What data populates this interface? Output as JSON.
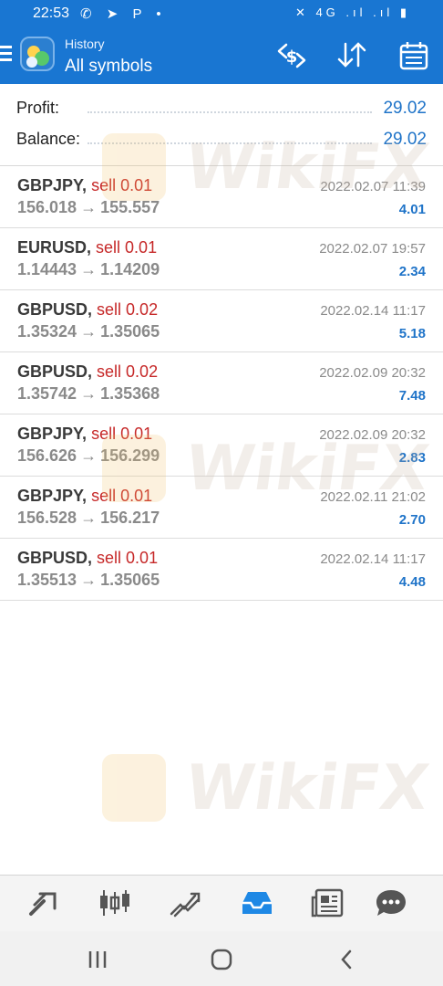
{
  "status_bar": {
    "time": "22:53",
    "left_icons": "✆ ➤ P •",
    "right_icons": "✕ 4G .ıl .ıl ▮"
  },
  "header": {
    "subtitle": "History",
    "title": "All symbols",
    "icons": [
      "menu-icon",
      "exchange-icon",
      "sort-icon",
      "calendar-icon"
    ]
  },
  "summary": {
    "profit_label": "Profit:",
    "profit_value": "29.02",
    "balance_label": "Balance:",
    "balance_value": "29.02"
  },
  "trades": [
    {
      "symbol": "GBPJPY,",
      "side": "sell 0.01",
      "open": "156.018",
      "arrow": "→",
      "close": "155.557",
      "time": "2022.02.07 11:39",
      "profit": "4.01"
    },
    {
      "symbol": "EURUSD,",
      "side": "sell 0.01",
      "open": "1.14443",
      "arrow": "→",
      "close": "1.14209",
      "time": "2022.02.07 19:57",
      "profit": "2.34"
    },
    {
      "symbol": "GBPUSD,",
      "side": "sell 0.02",
      "open": "1.35324",
      "arrow": "→",
      "close": "1.35065",
      "time": "2022.02.14 11:17",
      "profit": "5.18"
    },
    {
      "symbol": "GBPUSD,",
      "side": "sell 0.02",
      "open": "1.35742",
      "arrow": "→",
      "close": "1.35368",
      "time": "2022.02.09 20:32",
      "profit": "7.48"
    },
    {
      "symbol": "GBPJPY,",
      "side": "sell 0.01",
      "open": "156.626",
      "arrow": "→",
      "close": "156.299",
      "time": "2022.02.09 20:32",
      "profit": "2.83"
    },
    {
      "symbol": "GBPJPY,",
      "side": "sell 0.01",
      "open": "156.528",
      "arrow": "→",
      "close": "156.217",
      "time": "2022.02.11 21:02",
      "profit": "2.70"
    },
    {
      "symbol": "GBPUSD,",
      "side": "sell 0.01",
      "open": "1.35513",
      "arrow": "→",
      "close": "1.35065",
      "time": "2022.02.14 11:17",
      "profit": "4.48"
    }
  ],
  "watermark": {
    "text": "WikiFX"
  },
  "bottom_nav": {
    "items": [
      "quotes-icon",
      "chart-icon",
      "trade-icon",
      "history-icon",
      "news-icon",
      "chat-icon"
    ],
    "active": "history-icon"
  },
  "colors": {
    "primary": "#1976d2",
    "profit_blue": "#1e73c8",
    "sell_red": "#c62828",
    "muted_gray": "#8a8a8a"
  }
}
